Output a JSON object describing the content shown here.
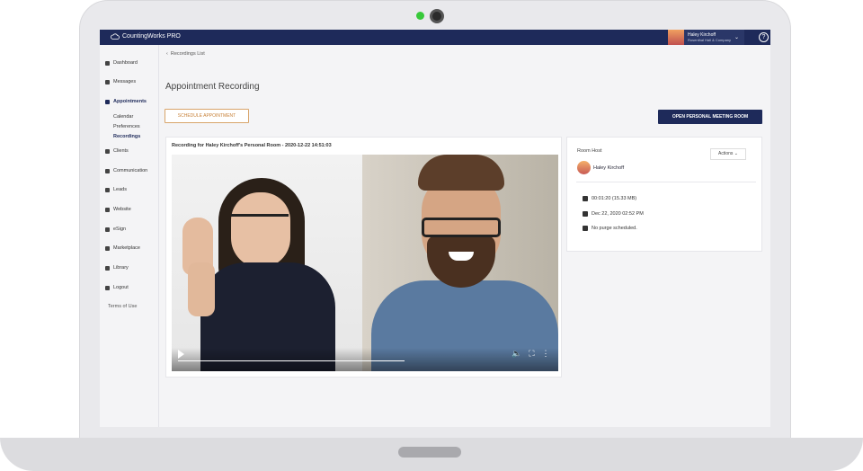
{
  "app": {
    "brand": "CountingWorks PRO"
  },
  "user": {
    "name": "Haley Kirchoff",
    "company": "Rosenthal Hall & Company"
  },
  "sidebar": {
    "items": [
      {
        "label": "Dashboard",
        "icon": "dashboard-icon"
      },
      {
        "label": "Messages",
        "icon": "chat-icon"
      },
      {
        "label": "Appointments",
        "icon": "calendar-icon"
      },
      {
        "label": "Clients",
        "icon": "users-icon"
      },
      {
        "label": "Communication",
        "icon": "mail-icon"
      },
      {
        "label": "Leads",
        "icon": "chart-icon"
      },
      {
        "label": "Website",
        "icon": "monitor-icon"
      },
      {
        "label": "eSign",
        "icon": "pen-icon"
      },
      {
        "label": "Marketplace",
        "icon": "store-icon"
      },
      {
        "label": "Library",
        "icon": "book-icon"
      },
      {
        "label": "Logout",
        "icon": "lock-icon"
      }
    ],
    "subitems": [
      "Calendar",
      "Preferences",
      "Recordings"
    ],
    "terms": "Terms of Use"
  },
  "main": {
    "breadcrumb": "Recordings List",
    "title": "Appointment Recording",
    "schedule_button": "SCHEDULE APPOINTMENT",
    "open_room_button": "OPEN PERSONAL MEETING ROOM",
    "recording_title": "Recording for Haley Kirchoff's Personal Room - 2020-12-22 14:51:03"
  },
  "details": {
    "room_host_label": "Room Host",
    "actions_label": "Actions",
    "host_name": "Haley Kirchoff",
    "duration": "00:01:20 (15.33 MB)",
    "date": "Dec 22, 2020 02:52 PM",
    "purge": "No purge scheduled."
  },
  "colors": {
    "navy": "#1e2a5a",
    "accent": "#c8823a"
  }
}
